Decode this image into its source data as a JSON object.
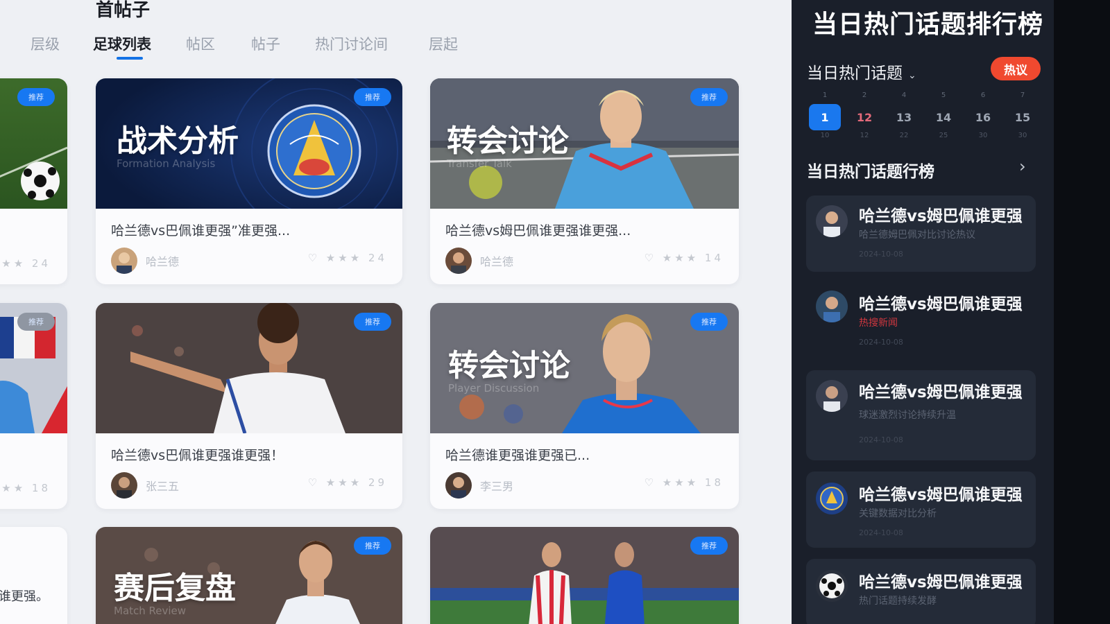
{
  "main": {
    "title": "首帖子",
    "tabs": [
      {
        "label": "层级"
      },
      {
        "label": "足球列表"
      },
      {
        "label": "帖区"
      },
      {
        "label": "帖子"
      },
      {
        "label": "热门讨论间"
      },
      {
        "label": "层起"
      }
    ],
    "active_tab": "足球列表",
    "cards": [
      {
        "overlay_title": "战术分析",
        "overlay_sub": "Formation Analysis",
        "badge": "推荐",
        "text": "哈兰德vs巴佩谁更强”准更强...",
        "author": "哈兰德",
        "stats": "♡ ★★★ 24"
      },
      {
        "overlay_title": "转会讨论",
        "overlay_sub": "Transfer Talk",
        "badge": "推荐",
        "text": "哈兰德vs姆巴佩谁更强谁更强...",
        "author": "哈兰德",
        "stats": "♡ ★★★ 14"
      },
      {
        "overlay_title": "",
        "overlay_sub": "",
        "badge": "推荐",
        "text": "哈兰德vs巴佩谁更强谁更强！",
        "author": "张三五",
        "stats": "♡ ★★★ 29"
      },
      {
        "overlay_title": "转会讨论",
        "overlay_sub": "Player Discussion",
        "badge": "推荐",
        "text": "哈兰德谁更强谁更强已...",
        "author": "李三男",
        "stats": "♡ ★★★ 18"
      },
      {
        "overlay_title": "赛后复盘",
        "overlay_sub": "Match Review",
        "badge": "推荐"
      },
      {
        "overlay_title": "",
        "overlay_sub": "",
        "badge": "推荐"
      }
    ],
    "left_cards": [
      {
        "badge": "推荐",
        "stats": "★★ 24"
      },
      {
        "badge": "推荐",
        "stats": "★★ 18"
      },
      {
        "text": "谁更强。"
      }
    ]
  },
  "panel": {
    "title": "当日热门话题排行榜",
    "subtitle": "当日热门话题",
    "hot_label": "热议",
    "days": [
      {
        "top": "1",
        "num": "1",
        "bot": "10"
      },
      {
        "top": "2",
        "num": "12",
        "bot": "12"
      },
      {
        "top": "4",
        "num": "13",
        "bot": "22"
      },
      {
        "top": "5",
        "num": "14",
        "bot": "25"
      },
      {
        "top": "6",
        "num": "16",
        "bot": "30"
      },
      {
        "top": "7",
        "num": "15",
        "bot": "30"
      }
    ],
    "rank_heading": "当日热门话题行榜",
    "items": [
      {
        "title": "哈兰德vs姆巴佩谁更强",
        "desc": "哈兰德姆巴佩对比讨论热议",
        "time": "2024-10-08"
      },
      {
        "title": "哈兰德vs姆巴佩谁更强",
        "desc": "热搜新闻",
        "time": "2024-10-08"
      },
      {
        "title": "哈兰德vs姆巴佩谁更强",
        "desc": "球迷激烈讨论持续升温",
        "time": "2024-10-08"
      },
      {
        "title": "哈兰德vs姆巴佩谁更强",
        "desc": "关键数据对比分析",
        "time": "2024-10-08"
      },
      {
        "title": "哈兰德vs姆巴佩谁更强",
        "desc": "热门话题持续发酵",
        "time": ""
      }
    ]
  },
  "colors": {
    "accent": "#1473e6",
    "panel_bg": "#1a1f2a",
    "hot": "#f0492f",
    "page_bg": "#eef0f4"
  },
  "icons": {
    "rank_arrow": "chevron-right-icon",
    "subtitle_dropdown": "chevron-down-icon",
    "likes": "heart-icon",
    "rating": "star-icon"
  }
}
